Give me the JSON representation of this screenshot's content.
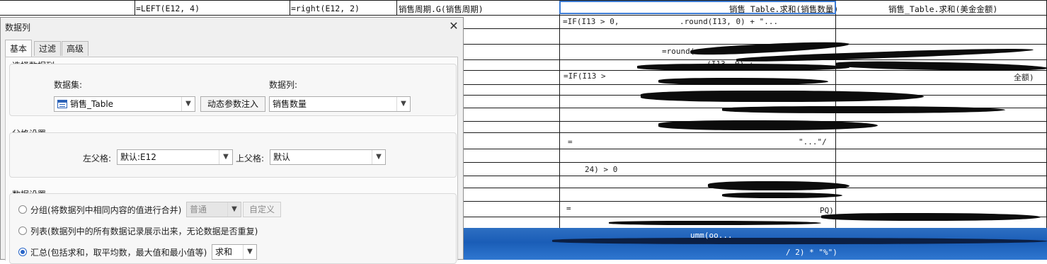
{
  "sheet": {
    "header_cells": {
      "left_formula": "=LEFT(E12, 4)",
      "right_formula": "=right(E12, 2)",
      "period_col": "销售周期.G(销售周期)",
      "sum_qty_col": "销售_Table.求和(销售数量)",
      "sum_amount_col": "销售_Table.求和(美金金额)"
    },
    "fragments": {
      "f1": "=IF(I13 > 0,",
      "f2": ".round(I13, 0) + \"...",
      "f3": "=round(sum",
      "f4": "..(I13, 0) +",
      "f5": "=IF(I13 >",
      "f6": "全额)",
      "f7": "=",
      "f8": "24) > 0",
      "f9": "=",
      "f10": "\"...\"/",
      "f11": "PQ)",
      "band1": "umm(oo...",
      "band2": "/ 2) * \"%\")"
    }
  },
  "dialog": {
    "title": "数据列",
    "close_symbol": "✕",
    "tabs": [
      "基本",
      "过滤",
      "高级"
    ],
    "select_column": {
      "group_title": "选择数据列",
      "dataset_label": "数据集:",
      "dataset_value": "销售_Table",
      "dynamic_param_button": "动态参数注入",
      "column_label": "数据列:",
      "column_value": "销售数量"
    },
    "parent_settings": {
      "group_title": "父格设置",
      "left_parent_label": "左父格:",
      "left_parent_value": "默认:E12",
      "top_parent_label": "上父格:",
      "top_parent_value": "默认"
    },
    "data_settings": {
      "group_title": "数据设置",
      "option_group": "分组(将数据列中相同内容的值进行合并)",
      "group_mode_value": "普通",
      "custom_button": "自定义",
      "option_list": "列表(数据列中的所有数据记录展示出来，无论数据是否重复)",
      "option_summary": "汇总(包括求和，取平均数，最大值和最小值等)",
      "summary_value": "求和",
      "selected_option": "summary"
    }
  },
  "colors": {
    "selection_border": "#3c7bd4",
    "band_blue": "#1a5db7",
    "dialog_bg": "#f0f0f0"
  }
}
